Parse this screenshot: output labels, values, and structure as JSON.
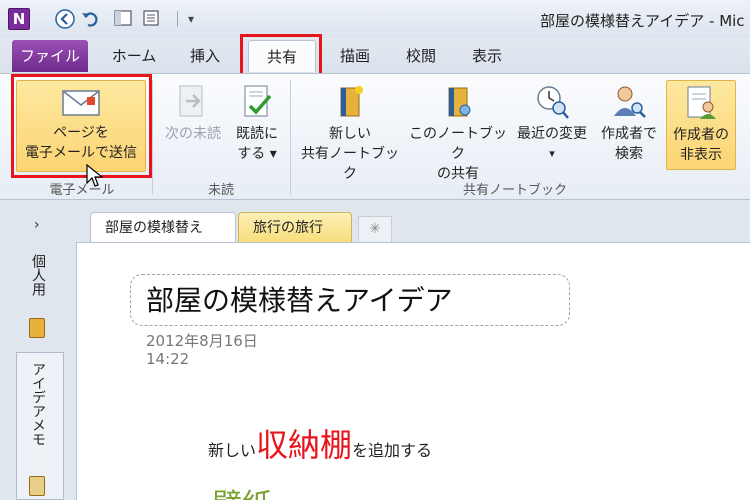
{
  "app": {
    "icon_letter": "N",
    "window_title": "部屋の模様替えアイデア - Mic"
  },
  "quick_access": {
    "back_icon": "back-arrow-icon",
    "undo_icon": "undo-icon",
    "dropdown_glyph": "⎟▾"
  },
  "tabs": [
    {
      "label": "ファイル"
    },
    {
      "label": "ホーム"
    },
    {
      "label": "挿入"
    },
    {
      "label": "共有"
    },
    {
      "label": "描画"
    },
    {
      "label": "校閲"
    },
    {
      "label": "表示"
    }
  ],
  "ribbon": {
    "email_page": {
      "line1": "ページを",
      "line2": "電子メールで送信"
    },
    "next_unread": {
      "line1": "次の未読"
    },
    "mark_read": {
      "line1": "既読に",
      "line2": "する ▾"
    },
    "new_shared_nb": {
      "line1": "新しい",
      "line2": "共有ノートブック"
    },
    "share_this_nb": {
      "line1": "このノートブック",
      "line2": "の共有"
    },
    "recent_changes": {
      "line1": "最近の変更",
      "line2": "▾"
    },
    "find_by_author": {
      "line1": "作成者で",
      "line2": "検索"
    },
    "hide_authors": {
      "line1": "作成者の",
      "line2": "非表示"
    },
    "groups": {
      "email": "電子メール",
      "unread": "未読",
      "shared_nb": "共有ノートブック"
    }
  },
  "nav": {
    "chevron": "›",
    "notebook1": "個人用",
    "notebook2": "アイデアメモ"
  },
  "sections": {
    "active": "部屋の模様替え",
    "second": "旅行の旅行",
    "new_glyph": "✳"
  },
  "page": {
    "title": "部屋の模様替えアイデア",
    "date": "2012年8月16日",
    "time": "14:22",
    "note_prefix": "新しい",
    "note_emph": "収納棚",
    "note_suffix": "を追加する",
    "green_heading": "壁紙"
  },
  "colors": {
    "file_tab": "#7a2d9a",
    "highlight_box": "#e8141b",
    "active_button": "#fcd574",
    "emph_text": "#e8141b",
    "green_text": "#7aa030"
  }
}
